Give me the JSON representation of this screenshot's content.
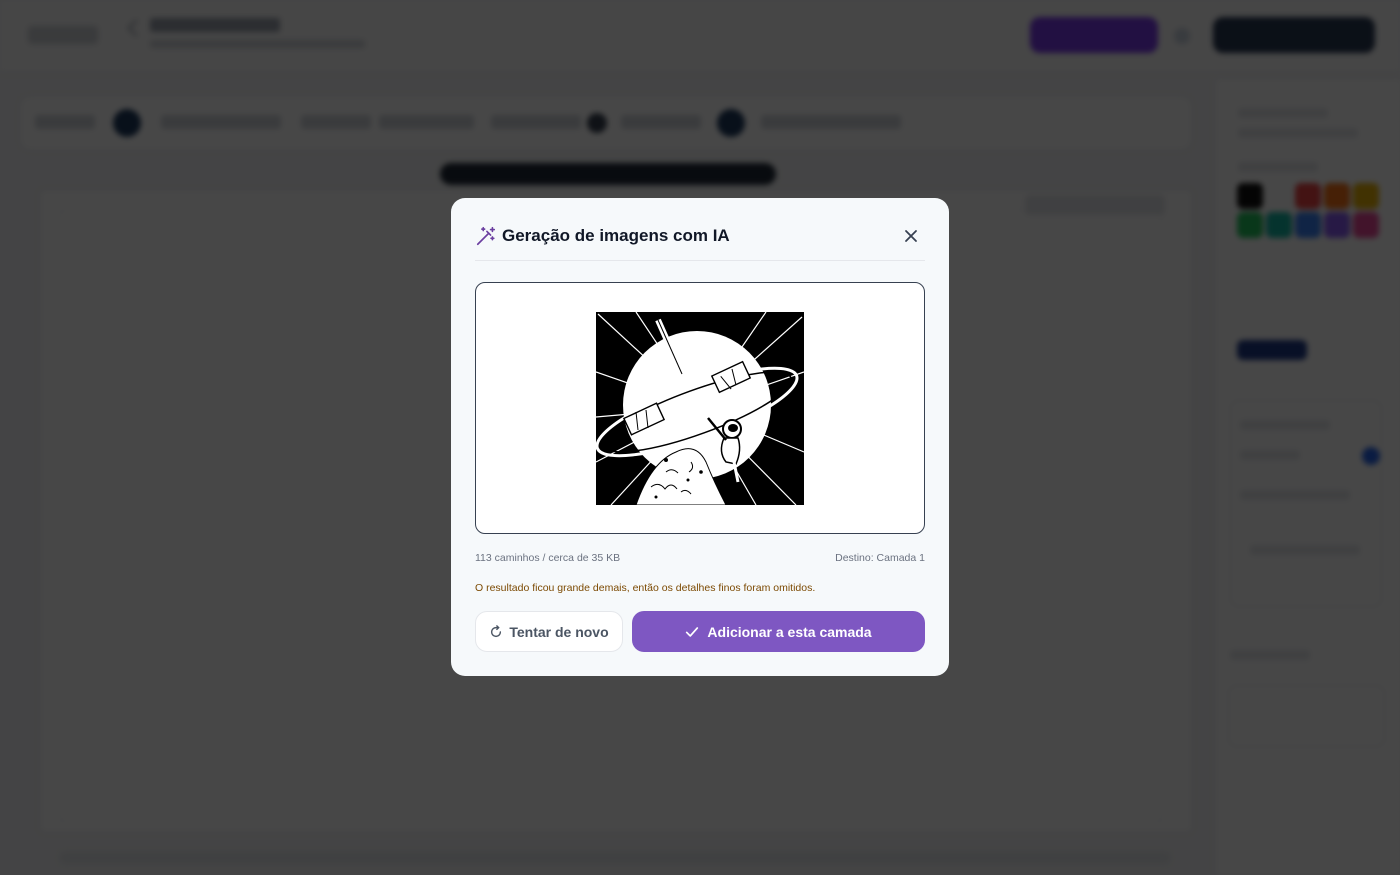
{
  "modal": {
    "title": "Geração de imagens com IA",
    "title_icon": "magic-wand-icon",
    "close_icon": "close-icon",
    "preview_description": "black-and-white vector illustration of an astronaut in space",
    "stats": "113 caminhos / cerca de 35 KB",
    "destination": "Destino: Camada 1",
    "warning": "O resultado ficou grande demais, então os detalhes finos foram omitidos.",
    "retry_button": {
      "label": "Tentar de novo",
      "icon": "refresh-icon"
    },
    "add_button": {
      "label": "Adicionar a esta camada",
      "icon": "check-icon"
    }
  },
  "colors": {
    "accent": "#7e57c2",
    "warning_text": "#7c4a03",
    "overlay": "rgba(0,0,0,0.72)",
    "swatches": [
      "#111111",
      "#ffffff",
      "#ef4444",
      "#f97316",
      "#eab308",
      "#22c55e",
      "#14b8a6",
      "#3b82f6",
      "#8b5cf6",
      "#ec4899"
    ]
  }
}
